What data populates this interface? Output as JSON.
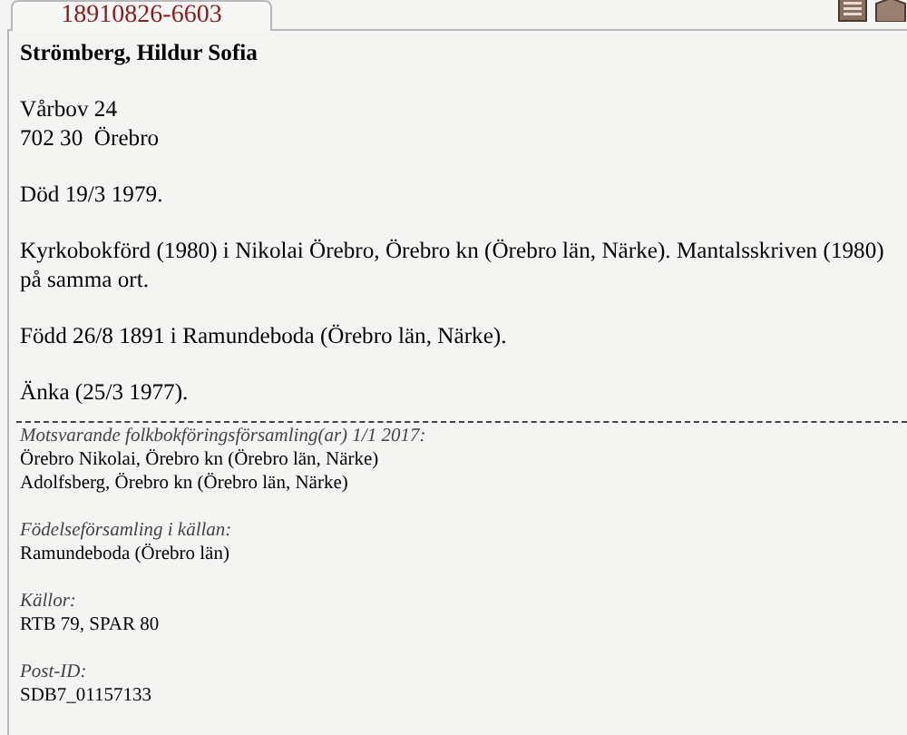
{
  "tab": {
    "label": "18910826-6603",
    "selected": true
  },
  "name": "Strömberg, Hildur Sofia",
  "address_lines": [
    "Vårbov 24",
    "702 30  Örebro"
  ],
  "paragraphs": [
    "Död 19/3 1979.",
    "Kyrkobokförd (1980) i Nikolai Örebro, Örebro kn (Örebro län, Närke). Mantalsskriven (1980) på samma ort.",
    "Född 26/8 1891 i Ramundeboda (Örebro län, Närke).",
    "Änka (25/3 1977)."
  ],
  "sections": [
    {
      "heading": "Motsvarande folkbokföringsförsamling(ar) 1/1 2017:",
      "lines": [
        "Örebro Nikolai, Örebro kn (Örebro län, Närke)",
        "Adolfsberg, Örebro kn (Örebro län, Närke)"
      ]
    },
    {
      "heading": "Födelseförsamling i källan:",
      "lines": [
        "Ramundeboda (Örebro län)"
      ]
    },
    {
      "heading": "Källor:",
      "lines": [
        "RTB 79, SPAR 80"
      ]
    },
    {
      "heading": "Post-ID:",
      "lines": [
        "SDB7_01157133"
      ]
    }
  ]
}
